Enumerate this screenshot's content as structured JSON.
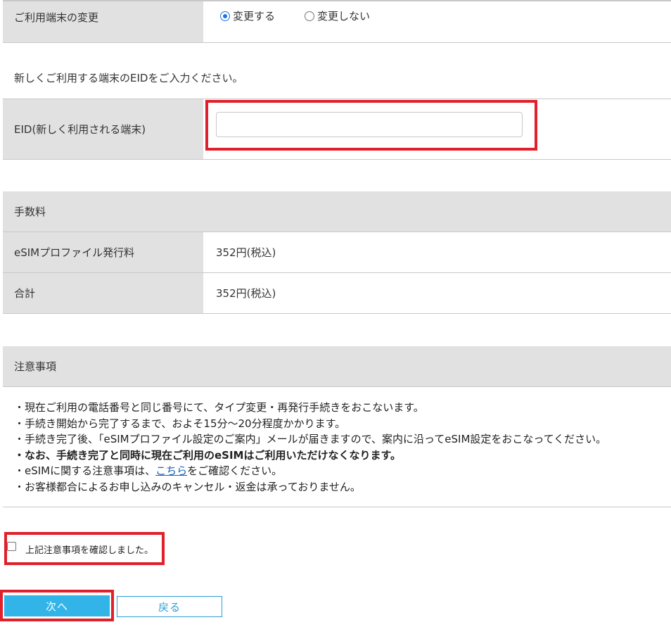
{
  "device_change": {
    "label": "ご利用端末の変更",
    "options": [
      {
        "label": "変更する",
        "checked": true
      },
      {
        "label": "変更しない",
        "checked": false
      }
    ]
  },
  "instruction": "新しくご利用する端末のEIDをご入力ください。",
  "eid": {
    "label": "EID(新しく利用される端末)",
    "value": ""
  },
  "fee": {
    "heading": "手数料",
    "rows": [
      {
        "label": "eSIMプロファイル発行料",
        "value": "352円(税込)"
      },
      {
        "label": "合計",
        "value": "352円(税込)"
      }
    ]
  },
  "notes": {
    "heading": "注意事項",
    "line1": "・現在ご利用の電話番号と同じ番号にて、タイプ変更・再発行手続きをおこないます。",
    "line2": "・手続き開始から完了するまで、およそ15分～20分程度かかります。",
    "line3": "・手続き完了後、「eSIMプロファイル設定のご案内」メールが届きますので、案内に沿ってeSIM設定をおこなってください。",
    "line4": "・なお、手続き完了と同時に現在ご利用のeSIMはご利用いただけなくなります。",
    "line5_pre": "・eSIMに関する注意事項は、",
    "line5_link": "こちら",
    "line5_post": "をご確認ください。",
    "line6": "・お客様都合によるお申し込みのキャンセル・返金は承っておりません。"
  },
  "confirm": {
    "label": "上記注意事項を確認しました。",
    "checked": false
  },
  "buttons": {
    "next": "次へ",
    "back": "戻る"
  },
  "colors": {
    "highlight": "#e0202a",
    "primary": "#33b4e8",
    "header_bg": "#e1e1e1"
  }
}
